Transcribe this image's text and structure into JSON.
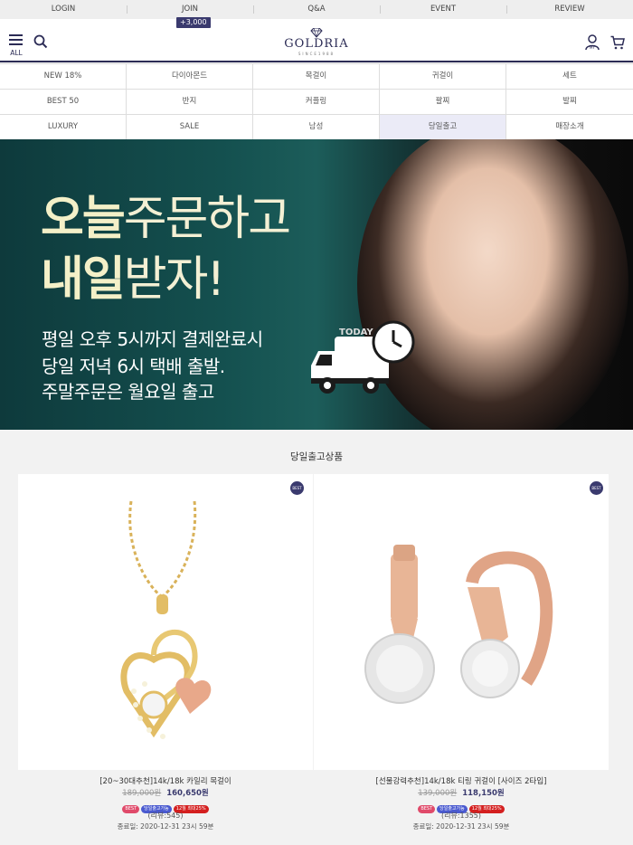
{
  "topnav": {
    "items": [
      "LOGIN",
      "JOIN",
      "Q&A",
      "EVENT",
      "REVIEW"
    ],
    "join_badge": "+3,000"
  },
  "header": {
    "menu_label": "ALL",
    "logo_name": "GOLDRIA",
    "logo_sub": "SINCE1988",
    "icons": [
      "menu-icon",
      "search-icon",
      "my-account-icon",
      "cart-icon"
    ],
    "accent_color": "#2b2b55"
  },
  "categories": [
    "NEW 18%",
    "다이아몬드",
    "목걸이",
    "귀걸이",
    "세트",
    "BEST 50",
    "반지",
    "커플링",
    "팔찌",
    "발찌",
    "LUXURY",
    "SALE",
    "남성",
    "당일출고",
    "매장소개"
  ],
  "active_category": "당일출고",
  "banner": {
    "line1_bold": "오늘",
    "line1_thin": "주문하고",
    "line2_bold": "내일",
    "line2_thin": "받자!",
    "sub1": "평일 오후 5시까지 결제완료시",
    "sub2": "당일 저녁 6시 택배 출발.",
    "sub3": "주말주문은 월요일 출고",
    "truck_label": "TODAY"
  },
  "section": {
    "title": "당일출고상품"
  },
  "products": [
    {
      "name": "[20~30대추천]14k/18k 카일리 목걸이",
      "old_price": "189,000원",
      "new_price": "160,650원",
      "tags": [
        "BEST",
        "당일출고가능",
        "12월 최대25%"
      ],
      "review": "(리뷰:545)",
      "end_date": "종료일: 2020-12-31 23시 59분",
      "badge": "BEST"
    },
    {
      "name": "[선물강력추천]14k/18k 티링 귀걸이 [사이즈 2타입]",
      "old_price": "139,000원",
      "new_price": "118,150원",
      "tags": [
        "BEST",
        "당일출고가능",
        "12월 최대25%"
      ],
      "review": "(리뷰:1355)",
      "end_date": "종료일: 2020-12-31 23시 59분",
      "badge": "BEST"
    }
  ]
}
